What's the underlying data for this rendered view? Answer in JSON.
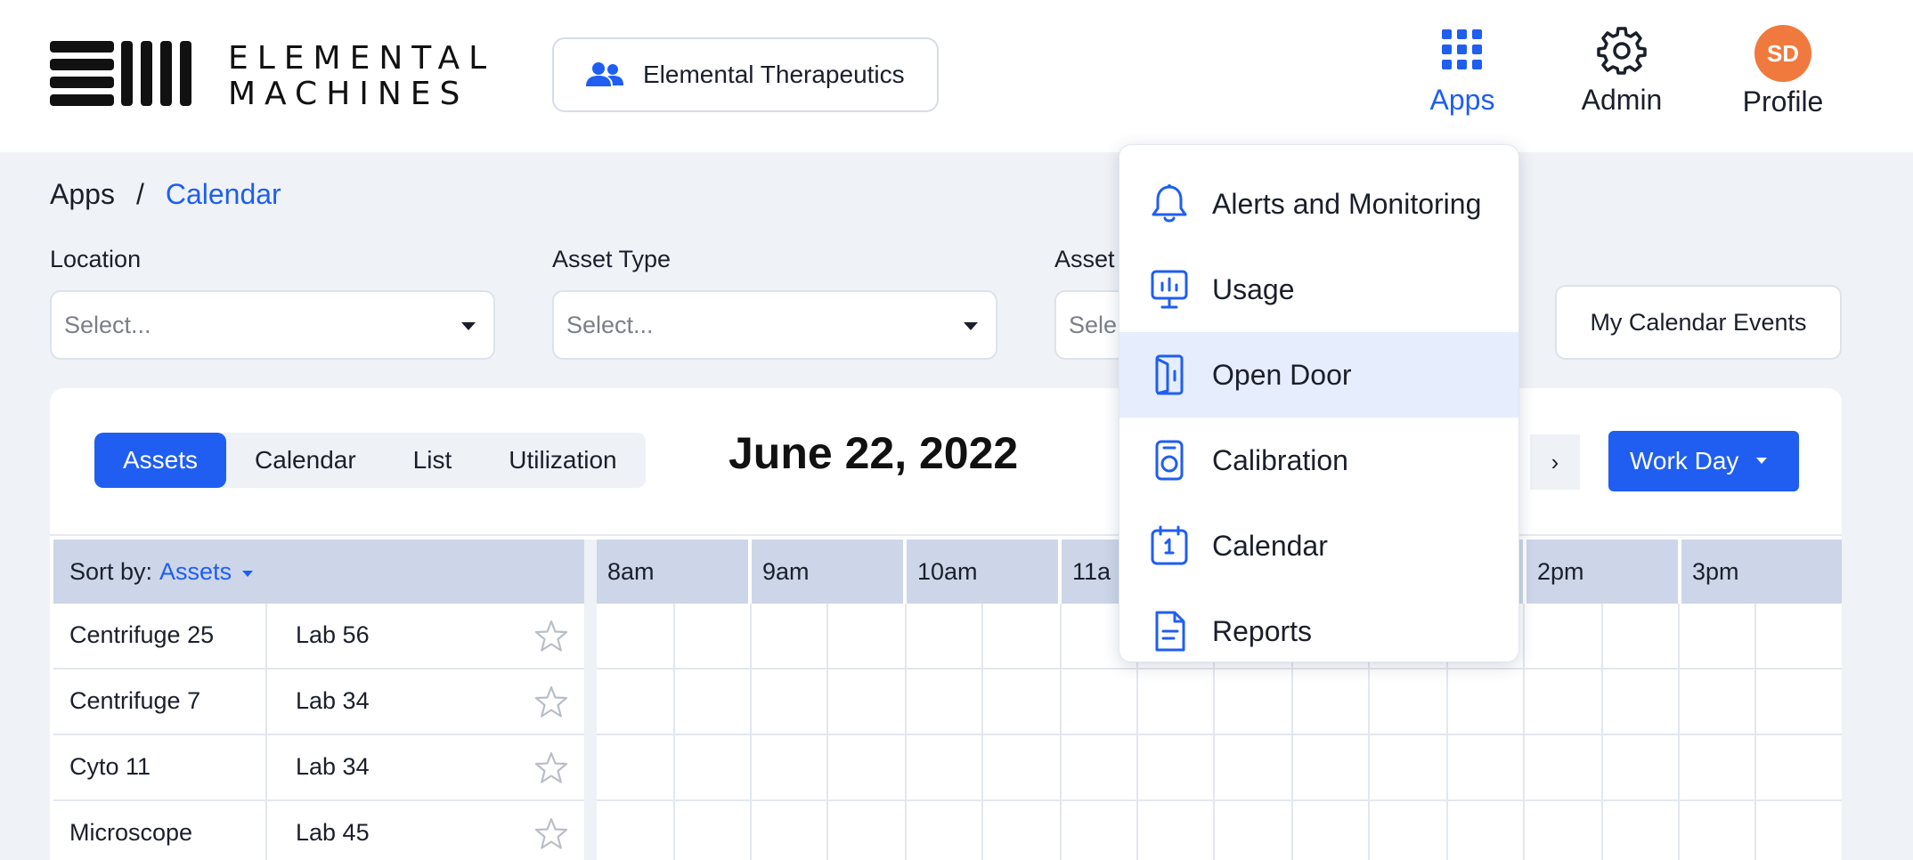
{
  "header": {
    "logo_line1": "ELEMENTAL",
    "logo_line2": "MACHINES",
    "org_name": "Elemental Therapeutics",
    "nav": {
      "apps": "Apps",
      "admin": "Admin",
      "profile": "Profile",
      "profile_initials": "SD"
    }
  },
  "breadcrumb": {
    "root": "Apps",
    "separator": "/",
    "current": "Calendar"
  },
  "filters": {
    "location": {
      "label": "Location",
      "placeholder": "Select..."
    },
    "asset_type": {
      "label": "Asset Type",
      "placeholder": "Select..."
    },
    "asset": {
      "label": "Asset",
      "placeholder": "Sele"
    },
    "my_events": "My Calendar Events"
  },
  "view": {
    "tabs": [
      "Assets",
      "Calendar",
      "List",
      "Utilization"
    ],
    "active_tab": "Assets",
    "date": "June 22, 2022",
    "next": "›",
    "range": "Work Day"
  },
  "table": {
    "sort_label": "Sort by:",
    "sort_value": "Assets",
    "rows": [
      {
        "name": "Centrifuge 25",
        "location": "Lab 56"
      },
      {
        "name": "Centrifuge 7",
        "location": "Lab 34"
      },
      {
        "name": "Cyto 11",
        "location": "Lab 34"
      },
      {
        "name": "Microscope",
        "location": "Lab 45"
      }
    ],
    "hours": [
      "8am",
      "9am",
      "10am",
      "11a",
      "",
      "",
      "2pm",
      "3pm"
    ]
  },
  "apps_menu": {
    "items": [
      {
        "label": "Alerts and Monitoring",
        "icon": "bell-icon"
      },
      {
        "label": "Usage",
        "icon": "usage-monitor-icon"
      },
      {
        "label": "Open Door",
        "icon": "door-icon"
      },
      {
        "label": "Calibration",
        "icon": "calibration-icon"
      },
      {
        "label": "Calendar",
        "icon": "calendar-icon"
      },
      {
        "label": "Reports",
        "icon": "report-icon"
      }
    ],
    "highlighted": "Open Door"
  },
  "colors": {
    "accent": "#1f5ef0",
    "avatar": "#f07a3e",
    "header_row": "#cdd6e8",
    "background": "#eff3f7"
  }
}
